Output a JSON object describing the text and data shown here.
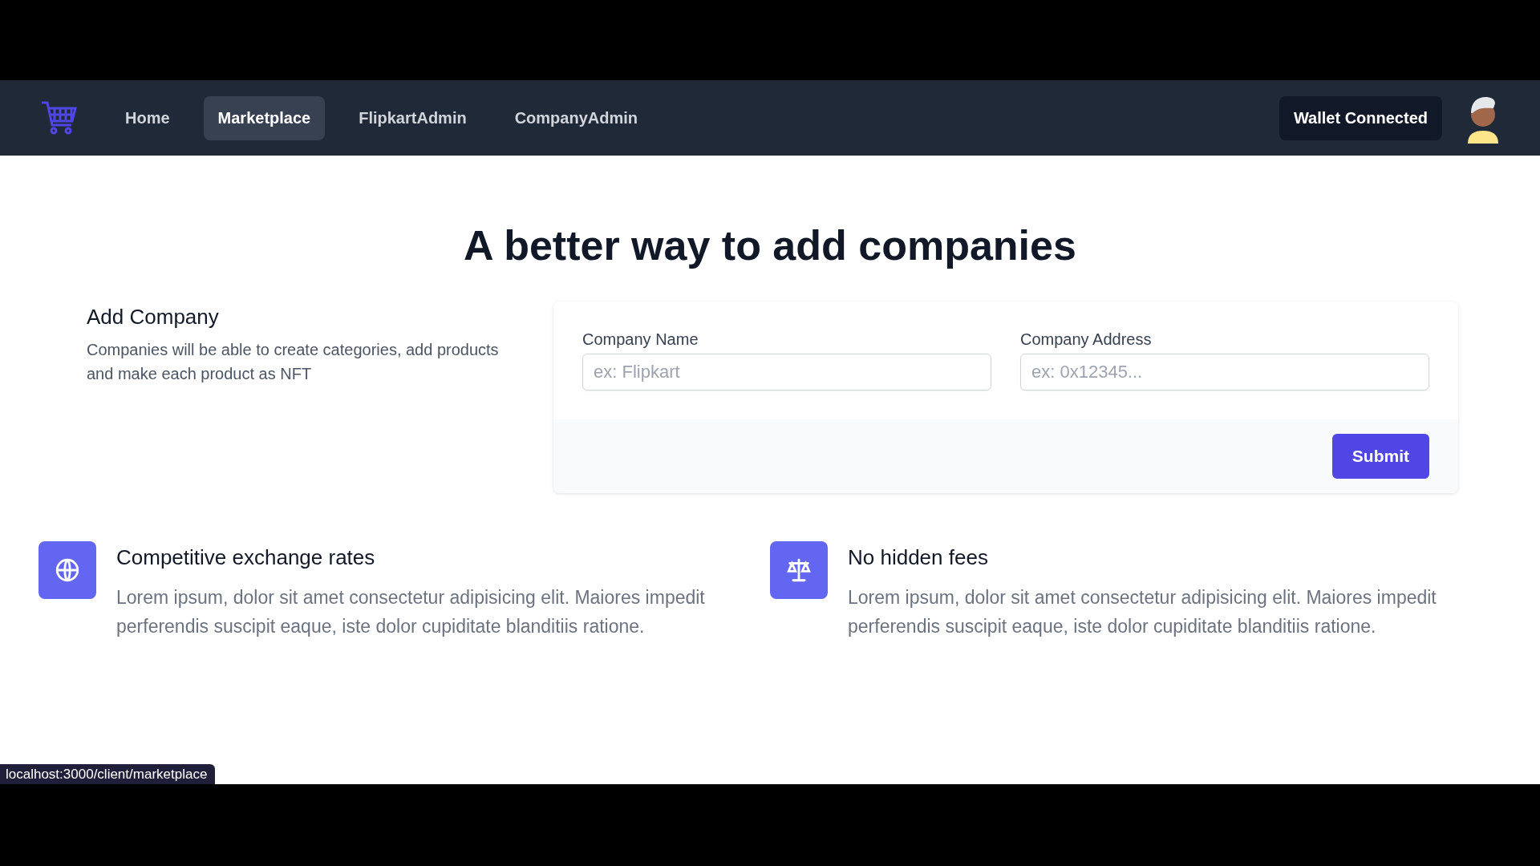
{
  "nav": {
    "items": [
      {
        "label": "Home",
        "selected": false
      },
      {
        "label": "Marketplace",
        "selected": true
      },
      {
        "label": "FlipkartAdmin",
        "selected": false
      },
      {
        "label": "CompanyAdmin",
        "selected": false
      }
    ],
    "wallet_button": "Wallet Connected"
  },
  "heading": "A better way to add companies",
  "form_section": {
    "title": "Add Company",
    "description": "Companies will be able to create categories, add products and make each product as NFT",
    "fields": [
      {
        "label": "Company Name",
        "placeholder": "ex: Flipkart"
      },
      {
        "label": "Company Address",
        "placeholder": "ex: 0x12345..."
      }
    ],
    "submit": "Submit"
  },
  "features": [
    {
      "kind": "globe",
      "title": "Competitive exchange rates",
      "text": "Lorem ipsum, dolor sit amet consectetur adipisicing elit. Maiores impedit perferendis suscipit eaque, iste dolor cupiditate blanditiis ratione."
    },
    {
      "kind": "scale",
      "title": "No hidden fees",
      "text": "Lorem ipsum, dolor sit amet consectetur adipisicing elit. Maiores impedit perferendis suscipit eaque, iste dolor cupiditate blanditiis ratione."
    }
  ],
  "status_bar": "localhost:3000/client/marketplace"
}
